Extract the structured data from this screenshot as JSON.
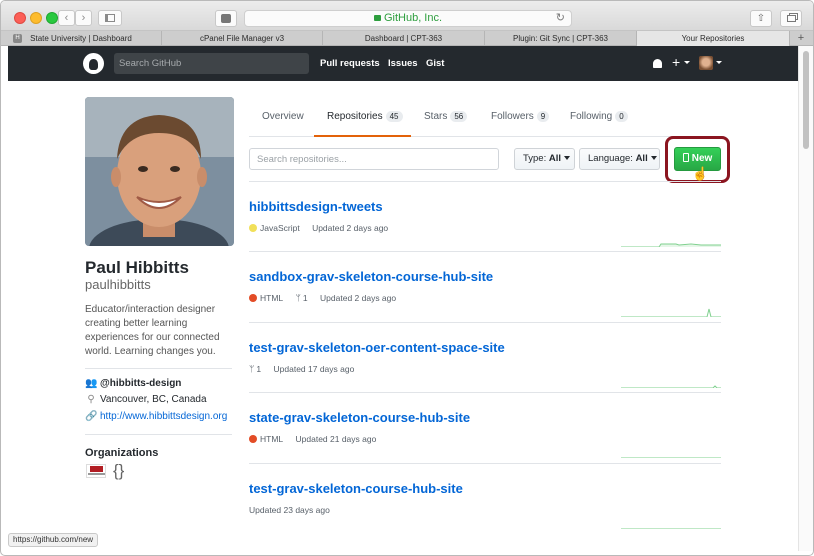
{
  "browser": {
    "url_text": "GitHub, Inc.",
    "tabs": [
      {
        "label": "State University | Dashboard",
        "favicon": "H",
        "active": false
      },
      {
        "label": "cPanel File Manager v3",
        "active": false
      },
      {
        "label": "Dashboard | CPT-363",
        "active": false
      },
      {
        "label": "Plugin: Git Sync | CPT-363",
        "active": false
      },
      {
        "label": "Your Repositories",
        "active": true
      }
    ],
    "new_tab_label": "+",
    "status_url": "https://github.com/new"
  },
  "header": {
    "search_placeholder": "Search GitHub",
    "nav": [
      "Pull requests",
      "Issues",
      "Gist"
    ],
    "plus_label": "+"
  },
  "profile": {
    "name": "Paul Hibbitts",
    "login": "paulhibbitts",
    "bio": "Educator/interaction designer creating better learning experiences for our connected world. Learning changes you.",
    "org_handle": "@hibbitts-design",
    "location": "Vancouver, BC, Canada",
    "website": "http://www.hibbittsdesign.org",
    "organizations_title": "Organizations",
    "org_brace": "{}"
  },
  "tabs": [
    {
      "label": "Overview",
      "count": null
    },
    {
      "label": "Repositories",
      "count": "45"
    },
    {
      "label": "Stars",
      "count": "56"
    },
    {
      "label": "Followers",
      "count": "9"
    },
    {
      "label": "Following",
      "count": "0"
    }
  ],
  "filters": {
    "search_placeholder": "Search repositories...",
    "type_label": "Type:",
    "type_value": "All",
    "language_label": "Language:",
    "language_value": "All",
    "new_button": "New"
  },
  "repos": [
    {
      "name": "hibbittsdesign-tweets",
      "language": "JavaScript",
      "lang_color": "#f1e05a",
      "forks": null,
      "updated": "Updated 2 days ago"
    },
    {
      "name": "sandbox-grav-skeleton-course-hub-site",
      "language": "HTML",
      "lang_color": "#e34c26",
      "forks": "1",
      "updated": "Updated 2 days ago"
    },
    {
      "name": "test-grav-skeleton-oer-content-space-site",
      "language": null,
      "lang_color": null,
      "forks": "1",
      "updated": "Updated 17 days ago"
    },
    {
      "name": "state-grav-skeleton-course-hub-site",
      "language": "HTML",
      "lang_color": "#e34c26",
      "forks": null,
      "updated": "Updated 21 days ago"
    },
    {
      "name": "test-grav-skeleton-course-hub-site",
      "language": null,
      "lang_color": null,
      "forks": null,
      "updated": "Updated 23 days ago"
    }
  ],
  "colors": {
    "accent_link": "#0366d6",
    "new_button_green": "#28a745",
    "highlight_box": "#8b1520",
    "selected_tab_underline": "#e36209",
    "sparkline": "#7fd08e"
  }
}
